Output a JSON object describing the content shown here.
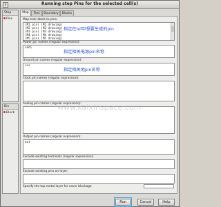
{
  "window": {
    "title": "Running step Pins for the selected cell(s)",
    "close_glyph": "x"
  },
  "left": {
    "step_header": "Step",
    "step_item": "Pins",
    "bin_header": "Bin",
    "bin_item": "Block"
  },
  "tabs": [
    "Map",
    "Text",
    "Boundary",
    "Blocks"
  ],
  "fields": {
    "map_text": {
      "label": "Map text labels to pins:",
      "lines": [
        "(M1 pin) (M1 drawing)",
        "(M2 pin) (M2 drawing)",
        "(M3 pin) (M3 drawing)",
        "(M4 pin) (M4 drawing)",
        "(M5 pin) (M5 drawing)"
      ],
      "note": "指定在lef中想要生成的pin"
    },
    "power": {
      "label": "Power pin names (regular expression):",
      "value": "vdd\\",
      "note": "指定相关电源pin名称"
    },
    "ground": {
      "label": "Ground pin names (regular expression):",
      "value": "vss",
      "note": "指定相关地pin名称"
    },
    "clock": {
      "label": "Clock pin names (regular expression):",
      "value": ""
    },
    "analog": {
      "label": "Analog pin names (regular expression):",
      "value": ""
    },
    "output": {
      "label": "Output pin names (regular expression):",
      "value": "out"
    },
    "excl_term": {
      "label": "Exclude existing terminals (regular expression):",
      "value": ""
    },
    "excl_layer": {
      "label": "Exclude existing pins on layer:",
      "value": ""
    }
  },
  "specify_label": "Specify the top metal layer for cover blockage",
  "watermark": "www.kaixinspace.com",
  "buttons": {
    "run": "Run",
    "cancel": "Cancel",
    "help": "Help"
  }
}
